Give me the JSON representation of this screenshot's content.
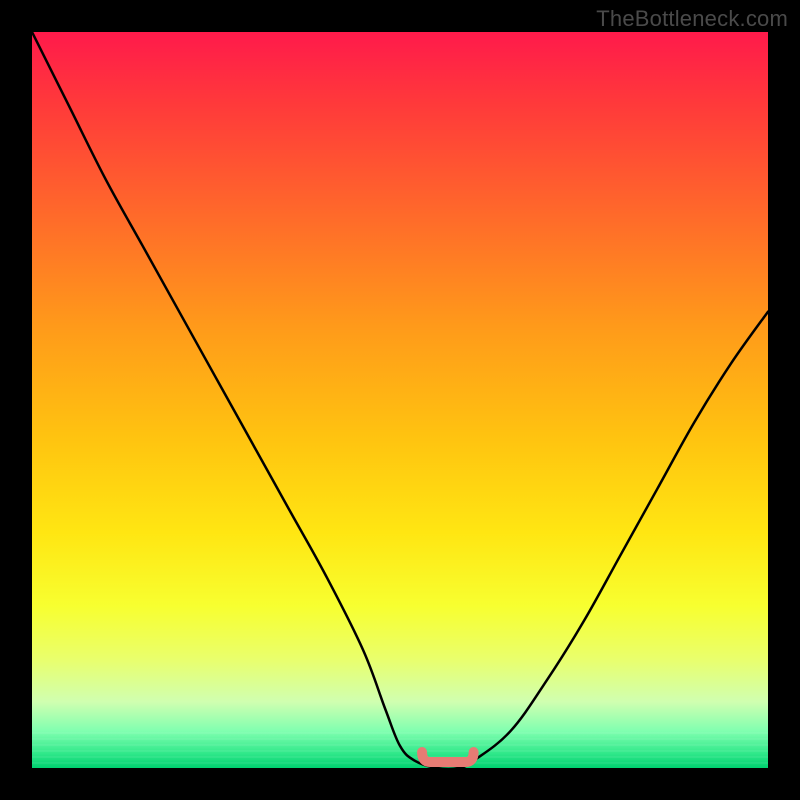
{
  "watermark": "TheBottleneck.com",
  "chart_data": {
    "type": "line",
    "title": "",
    "xlabel": "",
    "ylabel": "",
    "xlim": [
      0,
      100
    ],
    "ylim": [
      0,
      100
    ],
    "series": [
      {
        "name": "bottleneck-curve",
        "x": [
          0,
          5,
          10,
          15,
          20,
          25,
          30,
          35,
          40,
          45,
          48,
          50,
          52,
          55,
          58,
          60,
          65,
          70,
          75,
          80,
          85,
          90,
          95,
          100
        ],
        "values": [
          100,
          90,
          80,
          71,
          62,
          53,
          44,
          35,
          26,
          16,
          8,
          3,
          1,
          0,
          0,
          1,
          5,
          12,
          20,
          29,
          38,
          47,
          55,
          62
        ]
      }
    ],
    "annotations": [
      {
        "name": "valley-highlight",
        "x_range": [
          53,
          60
        ],
        "y": 0,
        "color": "#e77b74"
      }
    ],
    "gradient_stops": [
      {
        "pos": 0.0,
        "color": "#ff1a4b"
      },
      {
        "pos": 0.25,
        "color": "#ff6a2a"
      },
      {
        "pos": 0.55,
        "color": "#ffc310"
      },
      {
        "pos": 0.78,
        "color": "#f7ff30"
      },
      {
        "pos": 0.95,
        "color": "#80ffb0"
      },
      {
        "pos": 1.0,
        "color": "#00d070"
      }
    ]
  }
}
